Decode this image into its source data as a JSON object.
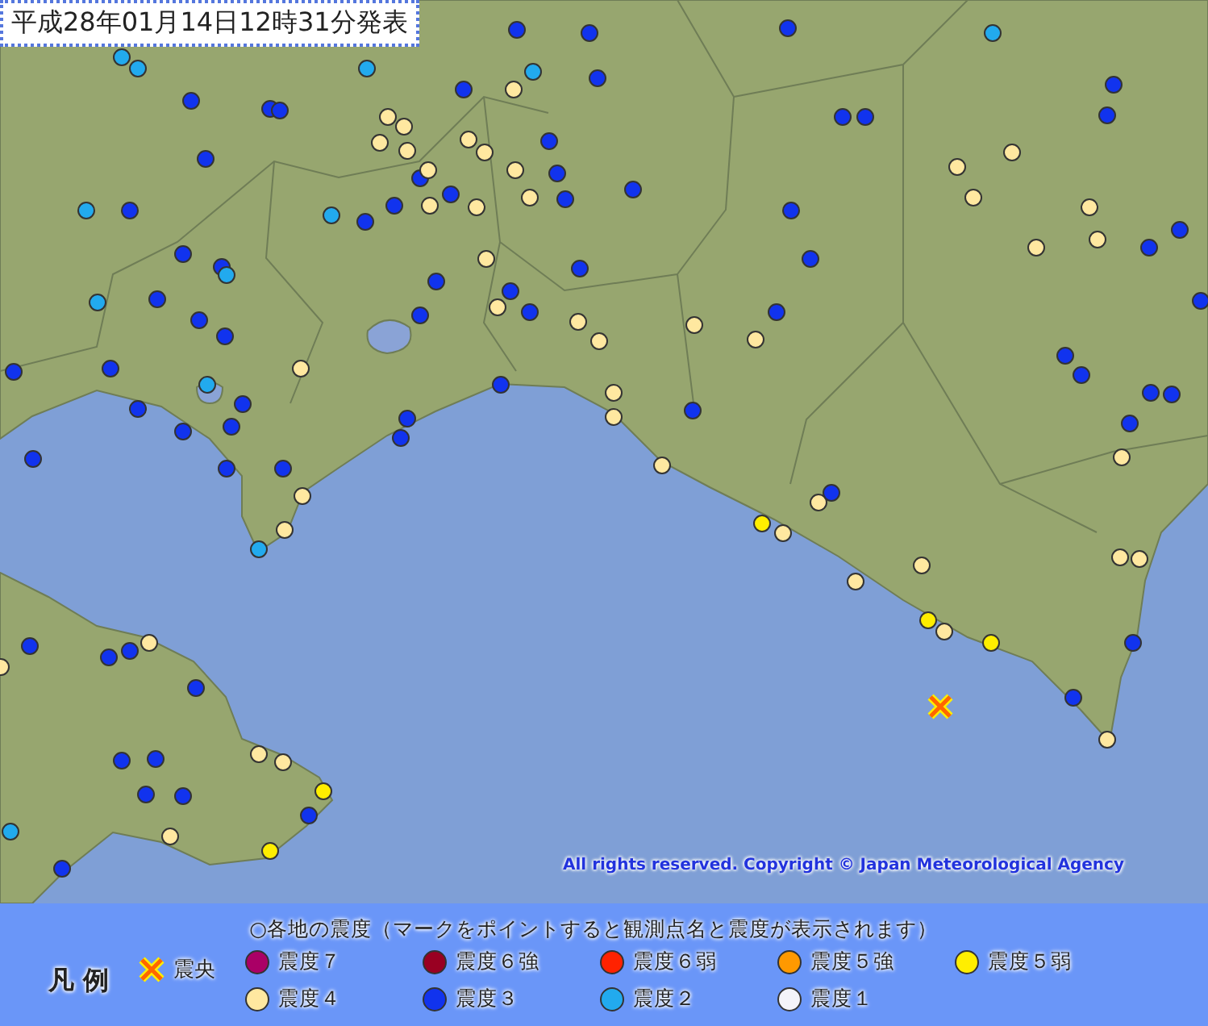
{
  "map": {
    "title": "平成28年01月14日12時31分発表",
    "copyright": "All rights reserved. Copyright © Japan Meteorological Agency",
    "epicenter": true,
    "stations": [
      {
        "color": "#1133ee"
      },
      {
        "color": "#1133ee"
      },
      {
        "color": "#1133ee"
      },
      {
        "color": "#1133ee"
      },
      {
        "color": "#1133ee"
      },
      {
        "color": "#1133ee"
      },
      {
        "color": "#1133ee"
      },
      {
        "color": "#1133ee"
      },
      {
        "color": "#1133ee"
      },
      {
        "color": "#1133ee"
      },
      {
        "color": "#1133ee"
      },
      {
        "color": "#1133ee"
      },
      {
        "color": "#1133ee"
      },
      {
        "color": "#1133ee"
      },
      {
        "color": "#1133ee"
      },
      {
        "color": "#1133ee"
      },
      {
        "color": "#1133ee"
      },
      {
        "color": "#1133ee"
      },
      {
        "color": "#1133ee"
      },
      {
        "color": "#1133ee"
      },
      {
        "color": "#1133ee"
      },
      {
        "color": "#1133ee"
      },
      {
        "color": "#1133ee"
      },
      {
        "color": "#1133ee"
      },
      {
        "color": "#1133ee"
      },
      {
        "color": "#1133ee"
      },
      {
        "color": "#1133ee"
      },
      {
        "color": "#1133ee"
      },
      {
        "color": "#1133ee"
      },
      {
        "color": "#1133ee"
      },
      {
        "color": "#1133ee"
      },
      {
        "color": "#1133ee"
      },
      {
        "color": "#1133ee"
      },
      {
        "color": "#1133ee"
      },
      {
        "color": "#1133ee"
      },
      {
        "color": "#1133ee"
      },
      {
        "color": "#1133ee"
      },
      {
        "color": "#1133ee"
      },
      {
        "color": "#1133ee"
      },
      {
        "color": "#1133ee"
      },
      {
        "color": "#1133ee"
      },
      {
        "color": "#1133ee"
      },
      {
        "color": "#1133ee"
      },
      {
        "color": "#1133ee"
      },
      {
        "color": "#1133ee"
      },
      {
        "color": "#1133ee"
      },
      {
        "color": "#1133ee"
      },
      {
        "color": "#1133ee"
      },
      {
        "color": "#1133ee"
      },
      {
        "color": "#1133ee"
      },
      {
        "color": "#1133ee"
      },
      {
        "color": "#1133ee"
      },
      {
        "color": "#1133ee"
      },
      {
        "color": "#1133ee"
      },
      {
        "color": "#1133ee"
      },
      {
        "color": "#1133ee"
      },
      {
        "color": "#1133ee"
      },
      {
        "color": "#1133ee"
      },
      {
        "color": "#1133ee"
      },
      {
        "color": "#1133ee"
      },
      {
        "color": "#1133ee"
      },
      {
        "color": "#1133ee"
      },
      {
        "color": "#1133ee"
      },
      {
        "color": "#1133ee"
      },
      {
        "color": "#1133ee"
      },
      {
        "color": "#1133ee"
      },
      {
        "color": "#1133ee"
      },
      {
        "color": "#1133ee"
      },
      {
        "color": "#1133ee"
      },
      {
        "color": "#22aaee"
      },
      {
        "color": "#22aaee"
      },
      {
        "color": "#22aaee"
      },
      {
        "color": "#22aaee"
      },
      {
        "color": "#22aaee"
      },
      {
        "color": "#22aaee"
      },
      {
        "color": "#22aaee"
      },
      {
        "color": "#22aaee"
      },
      {
        "color": "#22aaee"
      },
      {
        "color": "#22aaee"
      },
      {
        "color": "#22aaee"
      },
      {
        "color": "#22aaee"
      },
      {
        "color": "#ffe8a0"
      },
      {
        "color": "#ffe8a0"
      },
      {
        "color": "#ffe8a0"
      },
      {
        "color": "#ffe8a0"
      },
      {
        "color": "#ffe8a0"
      },
      {
        "color": "#ffe8a0"
      },
      {
        "color": "#ffe8a0"
      },
      {
        "color": "#ffe8a0"
      },
      {
        "color": "#ffe8a0"
      },
      {
        "color": "#ffe8a0"
      },
      {
        "color": "#ffe8a0"
      },
      {
        "color": "#ffe8a0"
      },
      {
        "color": "#ffe8a0"
      },
      {
        "color": "#ffe8a0"
      },
      {
        "color": "#ffe8a0"
      },
      {
        "color": "#ffe8a0"
      },
      {
        "color": "#ffe8a0"
      },
      {
        "color": "#ffe8a0"
      },
      {
        "color": "#ffe8a0"
      },
      {
        "color": "#ffe8a0"
      },
      {
        "color": "#ffe8a0"
      },
      {
        "color": "#ffe8a0"
      },
      {
        "color": "#ffe8a0"
      },
      {
        "color": "#ffe8a0"
      },
      {
        "color": "#ffe8a0"
      },
      {
        "color": "#ffe8a0"
      },
      {
        "color": "#ffe8a0"
      },
      {
        "color": "#ffe8a0"
      },
      {
        "color": "#ffe8a0"
      },
      {
        "color": "#ffe8a0"
      },
      {
        "color": "#ffe8a0"
      },
      {
        "color": "#ffe8a0"
      },
      {
        "color": "#ffe8a0"
      },
      {
        "color": "#ffe8a0"
      },
      {
        "color": "#ffe8a0"
      },
      {
        "color": "#ffe8a0"
      },
      {
        "color": "#ffe8a0"
      },
      {
        "color": "#ffe8a0"
      },
      {
        "color": "#ffe8a0"
      },
      {
        "color": "#ffe8a0"
      },
      {
        "color": "#ffe8a0"
      },
      {
        "color": "#ffe8a0"
      },
      {
        "color": "#ffe8a0"
      },
      {
        "color": "#ffe8a0"
      },
      {
        "color": "#ffee00"
      },
      {
        "color": "#ffee00"
      },
      {
        "color": "#ffee00"
      },
      {
        "color": "#ffee00"
      },
      {
        "color": "#ffee00"
      }
    ]
  },
  "legend": {
    "title": "凡 例",
    "epicenter_label": "震央",
    "header": "○各地の震度（マークをポイントすると観測点名と震度が表示されます）",
    "items": [
      {
        "label": "震度７",
        "color": "#aa0066"
      },
      {
        "label": "震度６強",
        "color": "#990022"
      },
      {
        "label": "震度６弱",
        "color": "#ff2200"
      },
      {
        "label": "震度５強",
        "color": "#ff9900"
      },
      {
        "label": "震度５弱",
        "color": "#ffee00"
      },
      {
        "label": "震度４",
        "color": "#ffe8a0"
      },
      {
        "label": "震度３",
        "color": "#1133ee"
      },
      {
        "label": "震度２",
        "color": "#22aaee"
      },
      {
        "label": "震度１",
        "color": "#f4f4fa"
      }
    ]
  }
}
